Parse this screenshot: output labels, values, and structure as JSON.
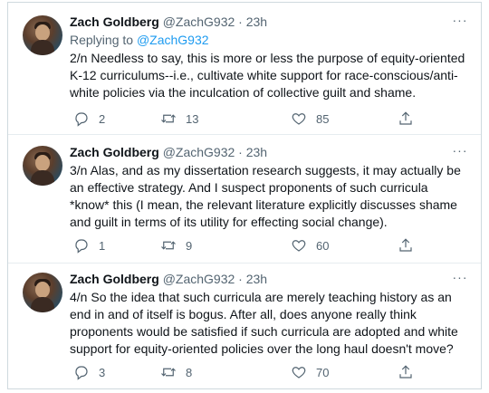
{
  "tweets": [
    {
      "name": "Zach Goldberg",
      "handle": "@ZachG932",
      "dot": "·",
      "time": "23h",
      "more_label": "···",
      "replying_prefix": "Replying to ",
      "replying_handle": "@ZachG932",
      "text": "2/n Needless to say, this is more or less the purpose of equity-oriented K-12 curriculums--i.e., cultivate white support for race-conscious/anti-white policies via the inculcation of collective guilt and shame.",
      "replies": "2",
      "retweets": "13",
      "likes": "85"
    },
    {
      "name": "Zach Goldberg",
      "handle": "@ZachG932",
      "dot": "·",
      "time": "23h",
      "more_label": "···",
      "text": "3/n Alas, and as my dissertation research suggests, it may actually be an effective strategy. And I suspect proponents of such curricula *know* this (I mean, the relevant literature explicitly discusses shame and guilt in terms of its utility for effecting social change).",
      "replies": "1",
      "retweets": "9",
      "likes": "60"
    },
    {
      "name": "Zach Goldberg",
      "handle": "@ZachG932",
      "dot": "·",
      "time": "23h",
      "more_label": "···",
      "text": "4/n So the idea that such curricula are merely teaching history as an end in and of itself is bogus. After all, does anyone really think proponents would be satisfied if such curricula are adopted and white support for equity-oriented policies over the long haul doesn't move?",
      "replies": "3",
      "retweets": "8",
      "likes": "70"
    }
  ],
  "icons": {
    "reply": "reply-icon",
    "retweet": "retweet-icon",
    "like": "heart-icon",
    "share": "share-icon",
    "more": "more-icon"
  },
  "colors": {
    "link": "#1d9bf0",
    "secondary": "#536471",
    "text": "#0f1419"
  }
}
